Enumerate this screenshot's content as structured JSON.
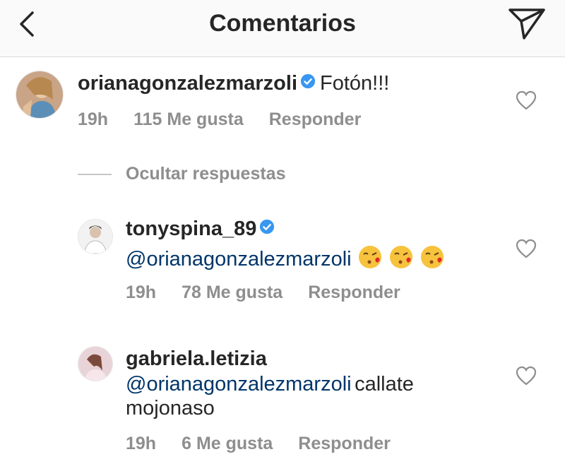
{
  "header": {
    "title": "Comentarios",
    "back_icon": "chevron-left-icon",
    "send_icon": "paper-plane-icon"
  },
  "comments": [
    {
      "username": "orianagonzalezmarzoli",
      "verified": true,
      "text": "Fotón!!!",
      "time": "19h",
      "likes": "115 Me gusta",
      "reply": "Responder"
    }
  ],
  "replies_toggle": "Ocultar respuestas",
  "replies": [
    {
      "username": "tonyspina_89",
      "verified": true,
      "mention": "@orianagonzalezmarzoli",
      "emoji": "kissing-face-emoji",
      "time": "19h",
      "likes": "78 Me gusta",
      "reply": "Responder"
    },
    {
      "username": "gabriela.letizia",
      "verified": false,
      "mention": "@orianagonzalezmarzoli",
      "text_after_mention": "callate",
      "text_line2": "mojonaso",
      "time": "19h",
      "likes": "6 Me gusta",
      "reply": "Responder"
    }
  ],
  "colors": {
    "text": "#262626",
    "meta": "#8e8e8e",
    "mention": "#003569",
    "verified": "#3897f0",
    "header_bg": "#fafafa"
  }
}
